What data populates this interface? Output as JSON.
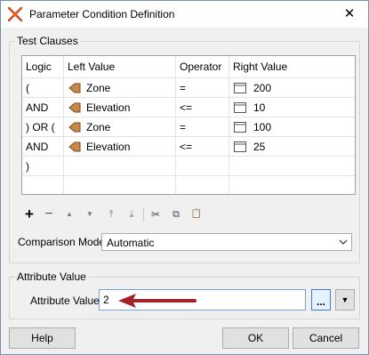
{
  "window": {
    "title": "Parameter Condition Definition",
    "close_glyph": "✕"
  },
  "test_clauses": {
    "group_label": "Test Clauses",
    "columns": [
      "Logic",
      "Left Value",
      "Operator",
      "Right Value"
    ],
    "rows": [
      {
        "logic": "(",
        "left": "Zone",
        "op": "=",
        "right": "200"
      },
      {
        "logic": "AND",
        "left": "Elevation",
        "op": "<=",
        "right": "10"
      },
      {
        "logic": ") OR (",
        "left": "Zone",
        "op": "=",
        "right": "100"
      },
      {
        "logic": "AND",
        "left": "Elevation",
        "op": "<=",
        "right": "25"
      },
      {
        "logic": ")",
        "left": "",
        "op": "",
        "right": ""
      }
    ],
    "toolbar": {
      "add_glyph": "+",
      "remove_glyph": "−",
      "move_up_glyph": "▲",
      "move_down_glyph": "▼",
      "move_top_glyph": "⤒",
      "move_bottom_glyph": "⤓",
      "cut_glyph": "✂",
      "copy_glyph": "⧉",
      "paste_glyph": "📋"
    },
    "comparison_mode_label": "Comparison Mode:",
    "comparison_mode_value": "Automatic"
  },
  "attribute_value": {
    "group_label": "Attribute Value",
    "field_label": "Attribute Value:",
    "field_value": "2",
    "ellipsis_label": "...",
    "dropdown_glyph": "▼"
  },
  "buttons": {
    "help": "Help",
    "ok": "OK",
    "cancel": "Cancel"
  },
  "colors": {
    "attribute_icon": "#c8884a",
    "arrow_annotation": "#a3232b",
    "accent_border": "#7aa0d4"
  }
}
